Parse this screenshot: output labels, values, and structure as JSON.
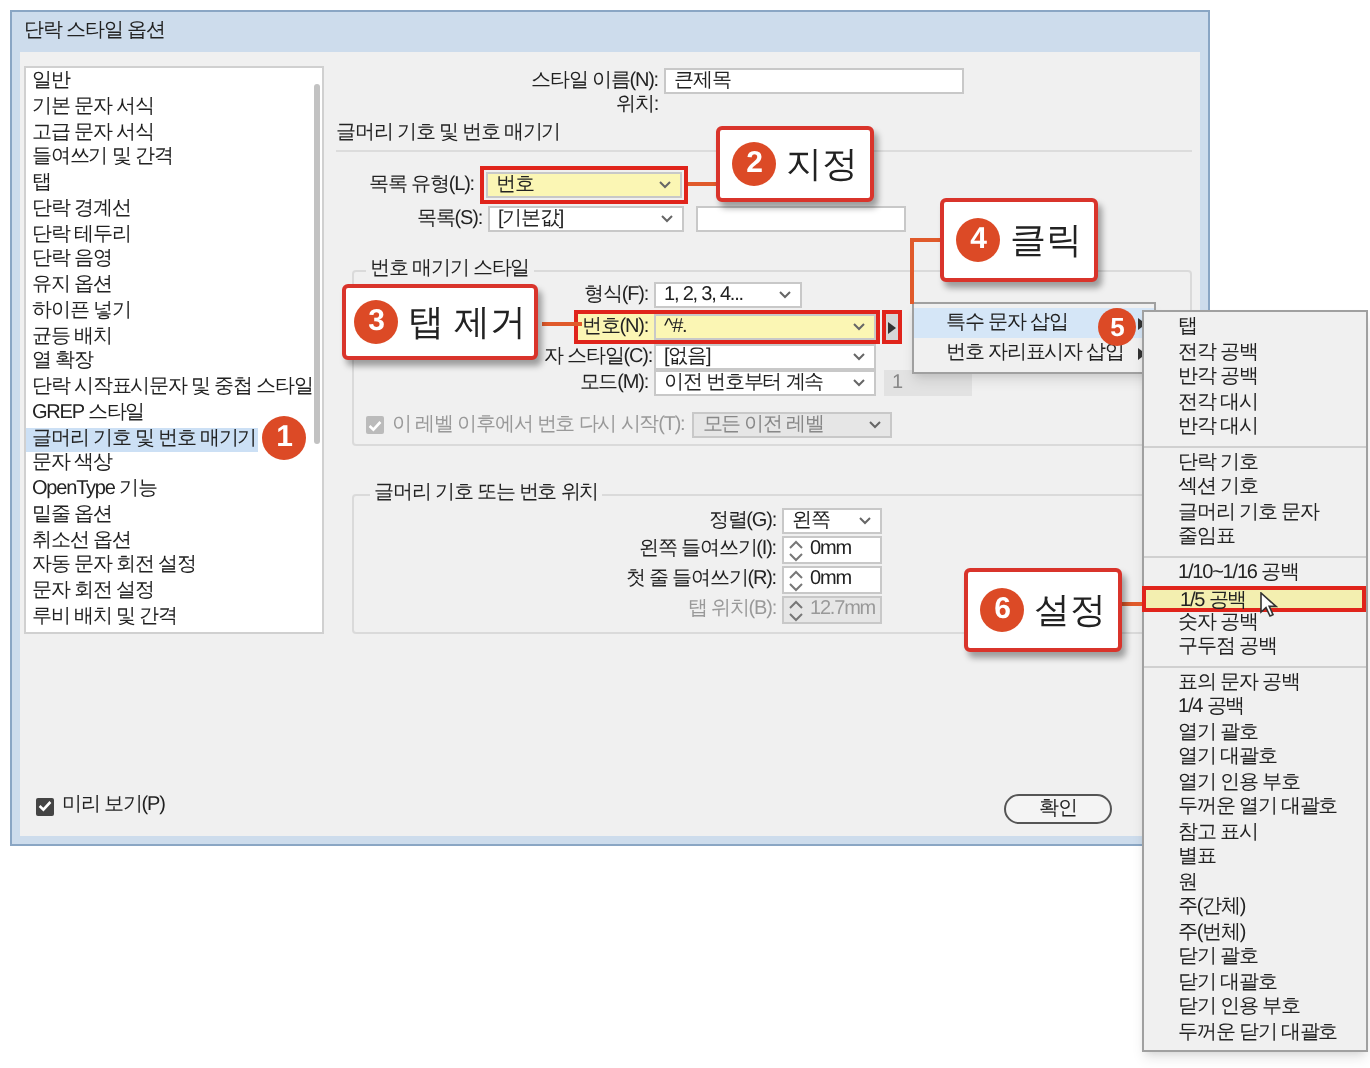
{
  "window": {
    "title": "단락 스타일 옵션"
  },
  "sidebar": {
    "items": [
      {
        "label": "일반",
        "selected": false
      },
      {
        "label": "기본 문자 서식",
        "selected": false
      },
      {
        "label": "고급 문자 서식",
        "selected": false
      },
      {
        "label": "들여쓰기 및 간격",
        "selected": false
      },
      {
        "label": "탭",
        "selected": false
      },
      {
        "label": "단락 경계선",
        "selected": false
      },
      {
        "label": "단락 테두리",
        "selected": false
      },
      {
        "label": "단락 음영",
        "selected": false
      },
      {
        "label": "유지 옵션",
        "selected": false
      },
      {
        "label": "하이픈 넣기",
        "selected": false
      },
      {
        "label": "균등 배치",
        "selected": false
      },
      {
        "label": "열 확장",
        "selected": false
      },
      {
        "label": "단락 시작표시문자 및 중첩 스타일",
        "selected": false
      },
      {
        "label": "GREP 스타일",
        "selected": false
      },
      {
        "label": "글머리 기호 및 번호 매기기",
        "selected": true
      },
      {
        "label": "문자 색상",
        "selected": false
      },
      {
        "label": "OpenType 기능",
        "selected": false
      },
      {
        "label": "밑줄 옵션",
        "selected": false
      },
      {
        "label": "취소선 옵션",
        "selected": false
      },
      {
        "label": "자동 문자 회전 설정",
        "selected": false
      },
      {
        "label": "문자 회전 설정",
        "selected": false
      },
      {
        "label": "루비 배치 및 간격",
        "selected": false
      }
    ]
  },
  "style_name": {
    "label": "스타일 이름(N):",
    "value": "큰제목"
  },
  "location": {
    "label": "위치:"
  },
  "section_title": "글머리 기호 및 번호 매기기",
  "list_type": {
    "label": "목록 유형(L):",
    "value": "번호",
    "highlighted": true
  },
  "list": {
    "label": "목록(S):",
    "value": "[기본값]"
  },
  "numbering_style": {
    "title": "번호 매기기 스타일",
    "format": {
      "label": "형식(F):",
      "value": "1, 2, 3, 4..."
    },
    "number": {
      "label": "번호(N):",
      "value": "^#.",
      "highlighted": true
    },
    "char_style": {
      "label": "자 스타일(C):",
      "value": "[없음]"
    },
    "mode": {
      "label": "모드(M):",
      "value": "이전 번호부터 계속",
      "start": {
        "value": "1",
        "disabled": true
      }
    },
    "restart": {
      "label": "이 레벨 이후에서 번호 다시 시작(T):",
      "checked": true,
      "disabled": true,
      "value": "모든 이전 레벨"
    }
  },
  "position": {
    "title": "글머리 기호 또는 번호 위치",
    "alignment": {
      "label": "정렬(G):",
      "value": "왼쪽"
    },
    "left_indent": {
      "label": "왼쪽 들여쓰기(I):",
      "value": "0mm",
      "disabled": false
    },
    "first_line_indent": {
      "label": "첫 줄 들여쓰기(R):",
      "value": "0mm",
      "disabled": false
    },
    "tab_position": {
      "label": "탭 위치(B):",
      "value": "12.7mm",
      "disabled": true
    }
  },
  "preview": {
    "label": "미리 보기(P)",
    "checked": true
  },
  "buttons": [
    {
      "label": "확인"
    }
  ],
  "insert_menu": {
    "items": [
      {
        "label": "특수 문자 삽입",
        "selected": true
      },
      {
        "label": "번호 자리표시자 삽입",
        "selected": false
      }
    ]
  },
  "special_char_menu": {
    "groups": [
      {
        "items": [
          {
            "label": "탭",
            "highlighted": false
          },
          {
            "label": "전각 공백",
            "highlighted": false
          },
          {
            "label": "반각 공백",
            "highlighted": false
          },
          {
            "label": "전각 대시",
            "highlighted": false
          },
          {
            "label": "반각 대시",
            "highlighted": false
          }
        ]
      },
      {
        "items": [
          {
            "label": "단락 기호",
            "highlighted": false
          },
          {
            "label": "섹션 기호",
            "highlighted": false
          },
          {
            "label": "글머리 기호 문자",
            "highlighted": false
          },
          {
            "label": "줄임표",
            "highlighted": false
          }
        ]
      },
      {
        "items": [
          {
            "label": "1/10~1/16 공백",
            "highlighted": false
          },
          {
            "label": "1/5 공백",
            "highlighted": true
          },
          {
            "label": "숫자 공백",
            "highlighted": false
          },
          {
            "label": "구두점 공백",
            "highlighted": false
          }
        ]
      },
      {
        "items": [
          {
            "label": "표의 문자 공백",
            "highlighted": false
          },
          {
            "label": "1/4 공백",
            "highlighted": false
          },
          {
            "label": "열기 괄호",
            "highlighted": false
          },
          {
            "label": "열기 대괄호",
            "highlighted": false
          },
          {
            "label": "열기 인용 부호",
            "highlighted": false
          },
          {
            "label": "두꺼운 열기 대괄호",
            "highlighted": false
          },
          {
            "label": "참고 표시",
            "highlighted": false
          },
          {
            "label": "별표",
            "highlighted": false
          },
          {
            "label": "원",
            "highlighted": false
          },
          {
            "label": "주(간체)",
            "highlighted": false
          },
          {
            "label": "주(번체)",
            "highlighted": false
          },
          {
            "label": "닫기 괄호",
            "highlighted": false
          },
          {
            "label": "닫기 대괄호",
            "highlighted": false
          },
          {
            "label": "닫기 인용 부호",
            "highlighted": false
          },
          {
            "label": "두꺼운 닫기 대괄호",
            "highlighted": false
          }
        ]
      }
    ]
  },
  "callouts": [
    {
      "kind": "badge",
      "number": "1"
    },
    {
      "kind": "box",
      "number": "2",
      "label": "지정"
    },
    {
      "kind": "box",
      "number": "3",
      "label": "탭 제거"
    },
    {
      "kind": "box",
      "number": "4",
      "label": "클릭"
    },
    {
      "kind": "badge",
      "number": "5"
    },
    {
      "kind": "box",
      "number": "6",
      "label": "설정"
    }
  ]
}
